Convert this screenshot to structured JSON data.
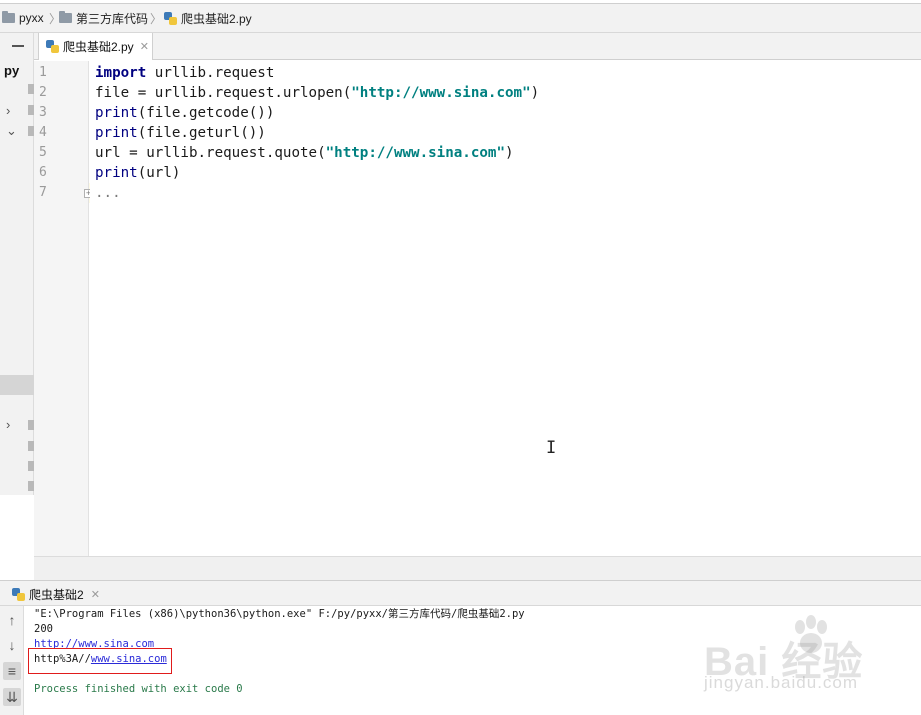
{
  "breadcrumb": {
    "items": [
      {
        "label": "pyxx",
        "icon": "folder-icon"
      },
      {
        "label": "第三方库代码",
        "icon": "folder-icon"
      },
      {
        "label": "爬虫基础2.py",
        "icon": "python-file-icon"
      }
    ]
  },
  "project_panel": {
    "root_label": "py"
  },
  "editor": {
    "tab": {
      "label": "爬虫基础2.py",
      "icon": "python-file-icon"
    },
    "line_numbers": [
      "1",
      "2",
      "3",
      "4",
      "5",
      "6",
      "7"
    ],
    "lines": [
      [
        {
          "t": "import",
          "c": "kw"
        },
        {
          "t": " urllib.request",
          "c": ""
        }
      ],
      [
        {
          "t": "file = urllib.request.urlopen(",
          "c": ""
        },
        {
          "t": "\"http://www.sina.com\"",
          "c": "str"
        },
        {
          "t": ")",
          "c": ""
        }
      ],
      [
        {
          "t": "print",
          "c": "bi"
        },
        {
          "t": "(file.getcode())",
          "c": ""
        }
      ],
      [
        {
          "t": "print",
          "c": "bi"
        },
        {
          "t": "(file.geturl())",
          "c": ""
        }
      ],
      [
        {
          "t": "url = urllib.request.quote(",
          "c": ""
        },
        {
          "t": "\"http://www.sina.com\"",
          "c": "str"
        },
        {
          "t": ")",
          "c": ""
        }
      ],
      [
        {
          "t": "print",
          "c": "bi"
        },
        {
          "t": "(url)",
          "c": ""
        }
      ],
      [
        {
          "t": "...",
          "c": "dots"
        }
      ]
    ],
    "current_line": "7"
  },
  "run_panel": {
    "tab_label": "爬虫基础2",
    "output": {
      "command": "\"E:\\Program Files (x86)\\python36\\python.exe\" F:/py/pyxx/第三方库代码/爬虫基础2.py",
      "code": "200",
      "url": "http://www.sina.com",
      "quoted_prefix": "http%3A//",
      "quoted_link": "www.sina.com",
      "exit": "Process finished with exit code 0"
    }
  },
  "watermark": {
    "logo": "Bai 经验",
    "site": "jingyan.baidu.com"
  },
  "colors": {
    "keyword": "#000080",
    "string": "#008080",
    "highlight_box": "#e01b1b",
    "current_line_bg": "#fffbe6"
  }
}
